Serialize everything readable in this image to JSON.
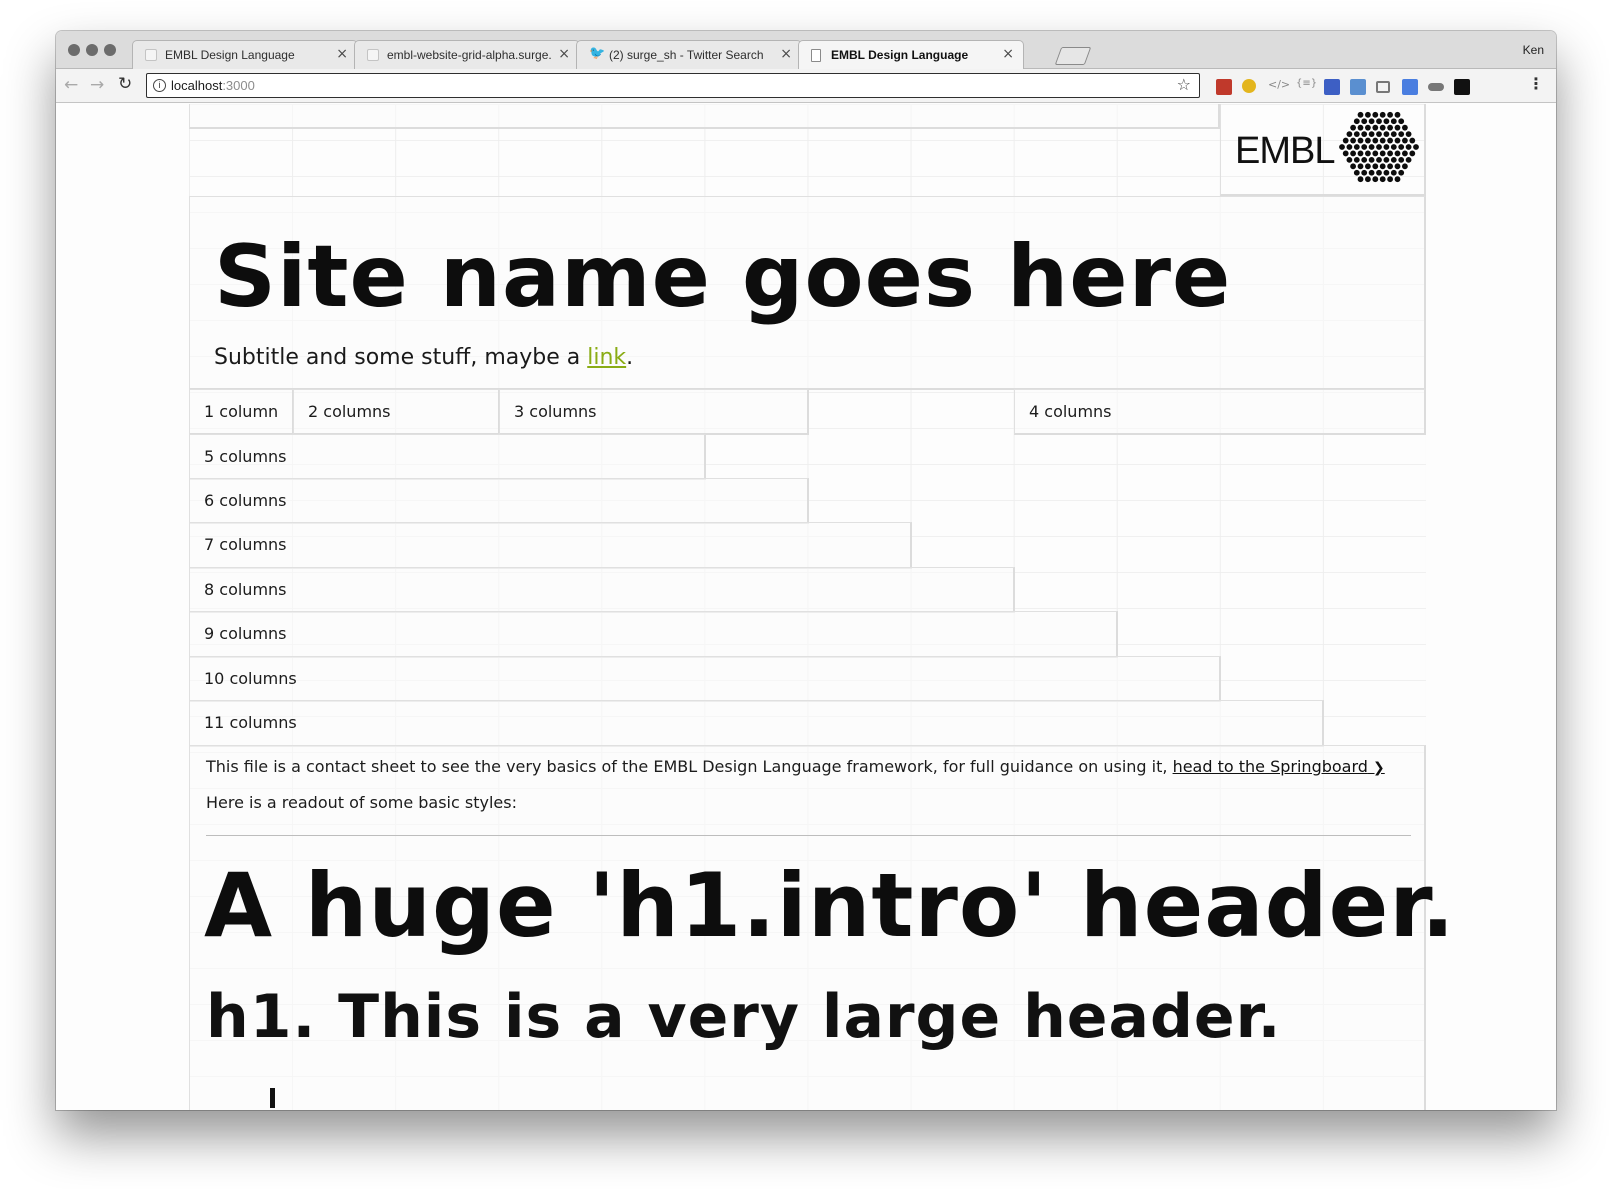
{
  "browser": {
    "tabs": [
      {
        "title": "EMBL Design Language",
        "favicon": "blank-page-icon",
        "active": false
      },
      {
        "title": "embl-website-grid-alpha.surge.sh",
        "favicon": "blank-page-icon",
        "active": false
      },
      {
        "title": "(2) surge_sh - Twitter Search",
        "favicon": "twitter-bird-icon",
        "active": false
      },
      {
        "title": "EMBL Design Language",
        "favicon": "document-icon",
        "active": true
      }
    ],
    "close_glyph": "×",
    "profile_name": "Ken",
    "url_host": "localhost",
    "url_port": ":3000",
    "info_glyph": "i",
    "star_glyph": "☆",
    "back_glyph": "←",
    "forward_glyph": "→",
    "reload_glyph": "↻",
    "menu_glyph": "⋮"
  },
  "header": {
    "logo_text": "EMBL",
    "site_title": "Site name goes here",
    "subtitle_before": "Subtitle and some stuff, maybe a ",
    "subtitle_link": "link",
    "subtitle_after": "."
  },
  "grid_demo": {
    "labels": [
      "1 column",
      "2 columns",
      "3 columns",
      "4 columns",
      "5 columns",
      "6 columns",
      "7 columns",
      "8 columns",
      "9 columns",
      "10 columns",
      "11 columns"
    ]
  },
  "intro": {
    "paragraph_before": "This file is a contact sheet to see the very basics of the EMBL Design Language framework, for full guidance on using it, ",
    "springboard_link": "head to the Springboard",
    "chevron_glyph": "❯",
    "readout_text": "Here is a readout of some basic styles:"
  },
  "typography": {
    "h1_intro": "A huge 'h1.intro' header.",
    "h1": "h1. This is a very large header."
  },
  "colors": {
    "link_green": "#8aac15",
    "text": "#1a1a1a"
  }
}
